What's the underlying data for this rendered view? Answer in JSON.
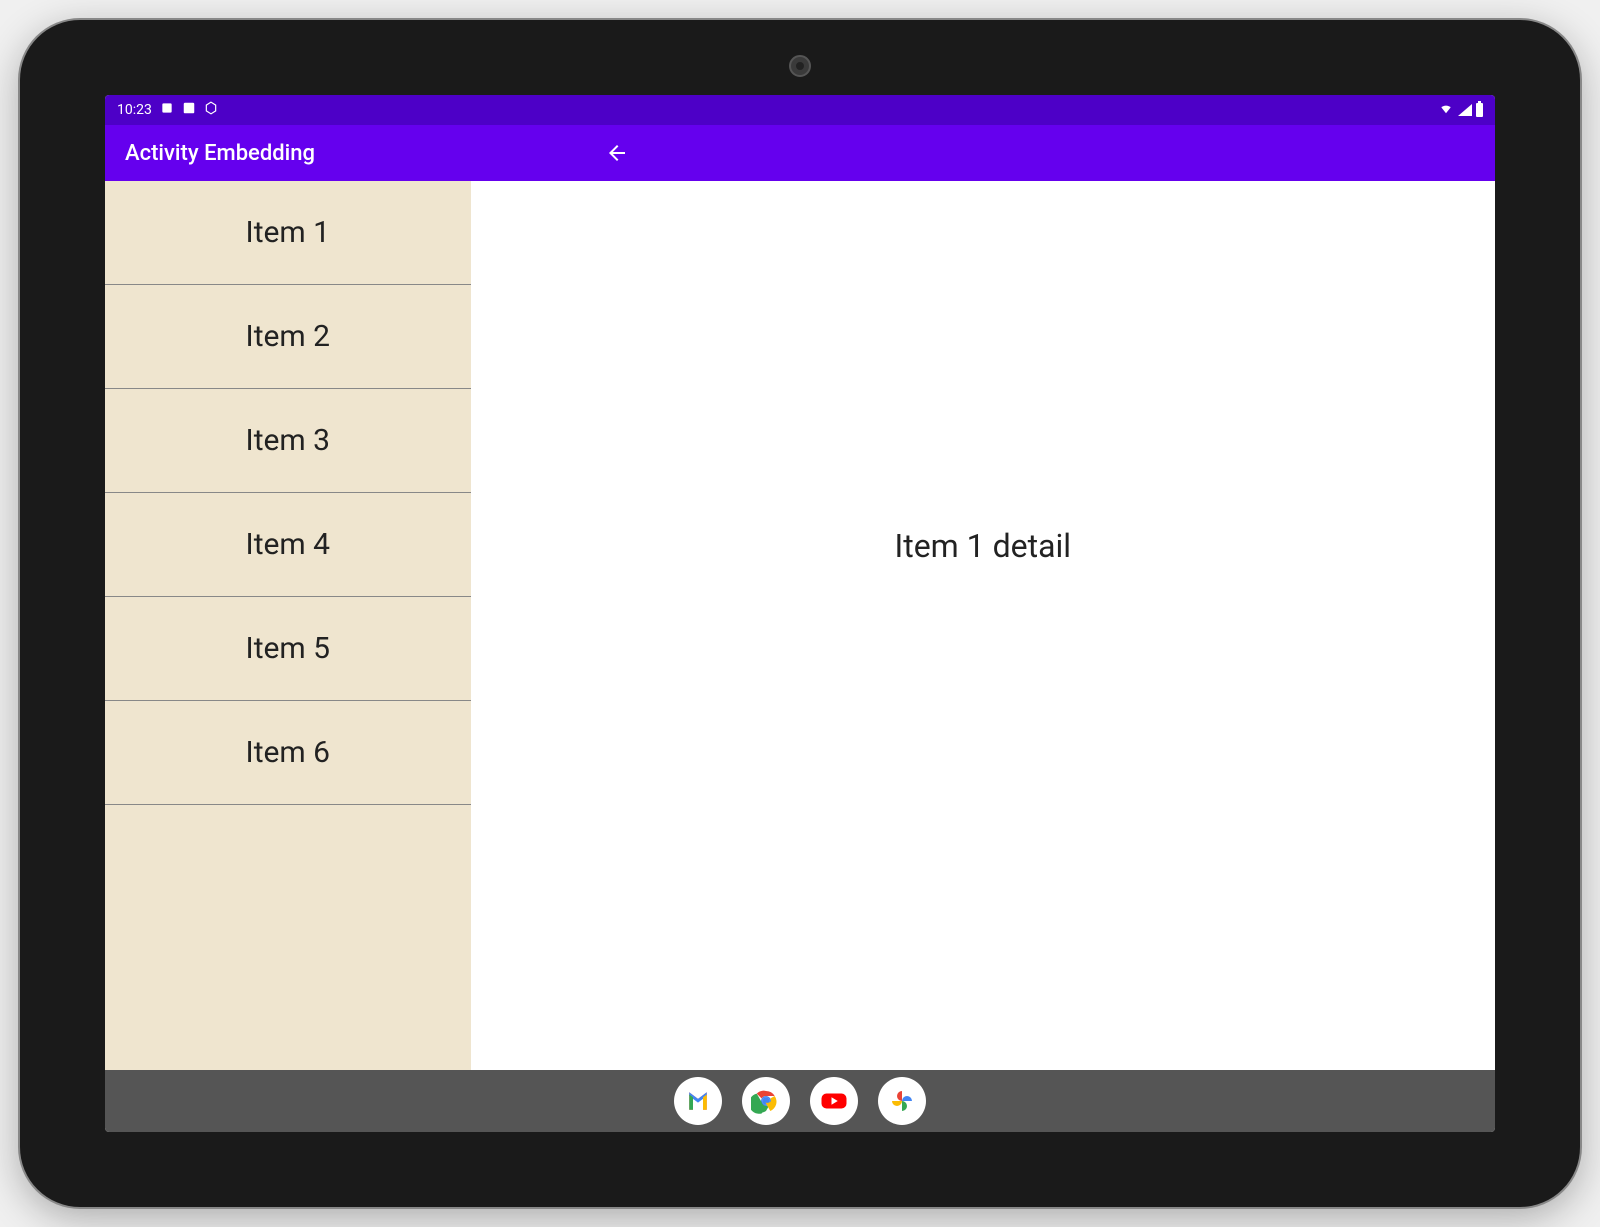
{
  "status_bar": {
    "time": "10:23"
  },
  "app_bar": {
    "title": "Activity Embedding"
  },
  "list": {
    "items": [
      {
        "label": "Item 1"
      },
      {
        "label": "Item 2"
      },
      {
        "label": "Item 3"
      },
      {
        "label": "Item 4"
      },
      {
        "label": "Item 5"
      },
      {
        "label": "Item 6"
      }
    ]
  },
  "detail": {
    "text": "Item 1 detail"
  },
  "colors": {
    "status_bar_bg": "#4d00c7",
    "app_bar_bg": "#6500ee",
    "list_bg": "#efe5cf",
    "nav_bar_bg": "#555555"
  }
}
